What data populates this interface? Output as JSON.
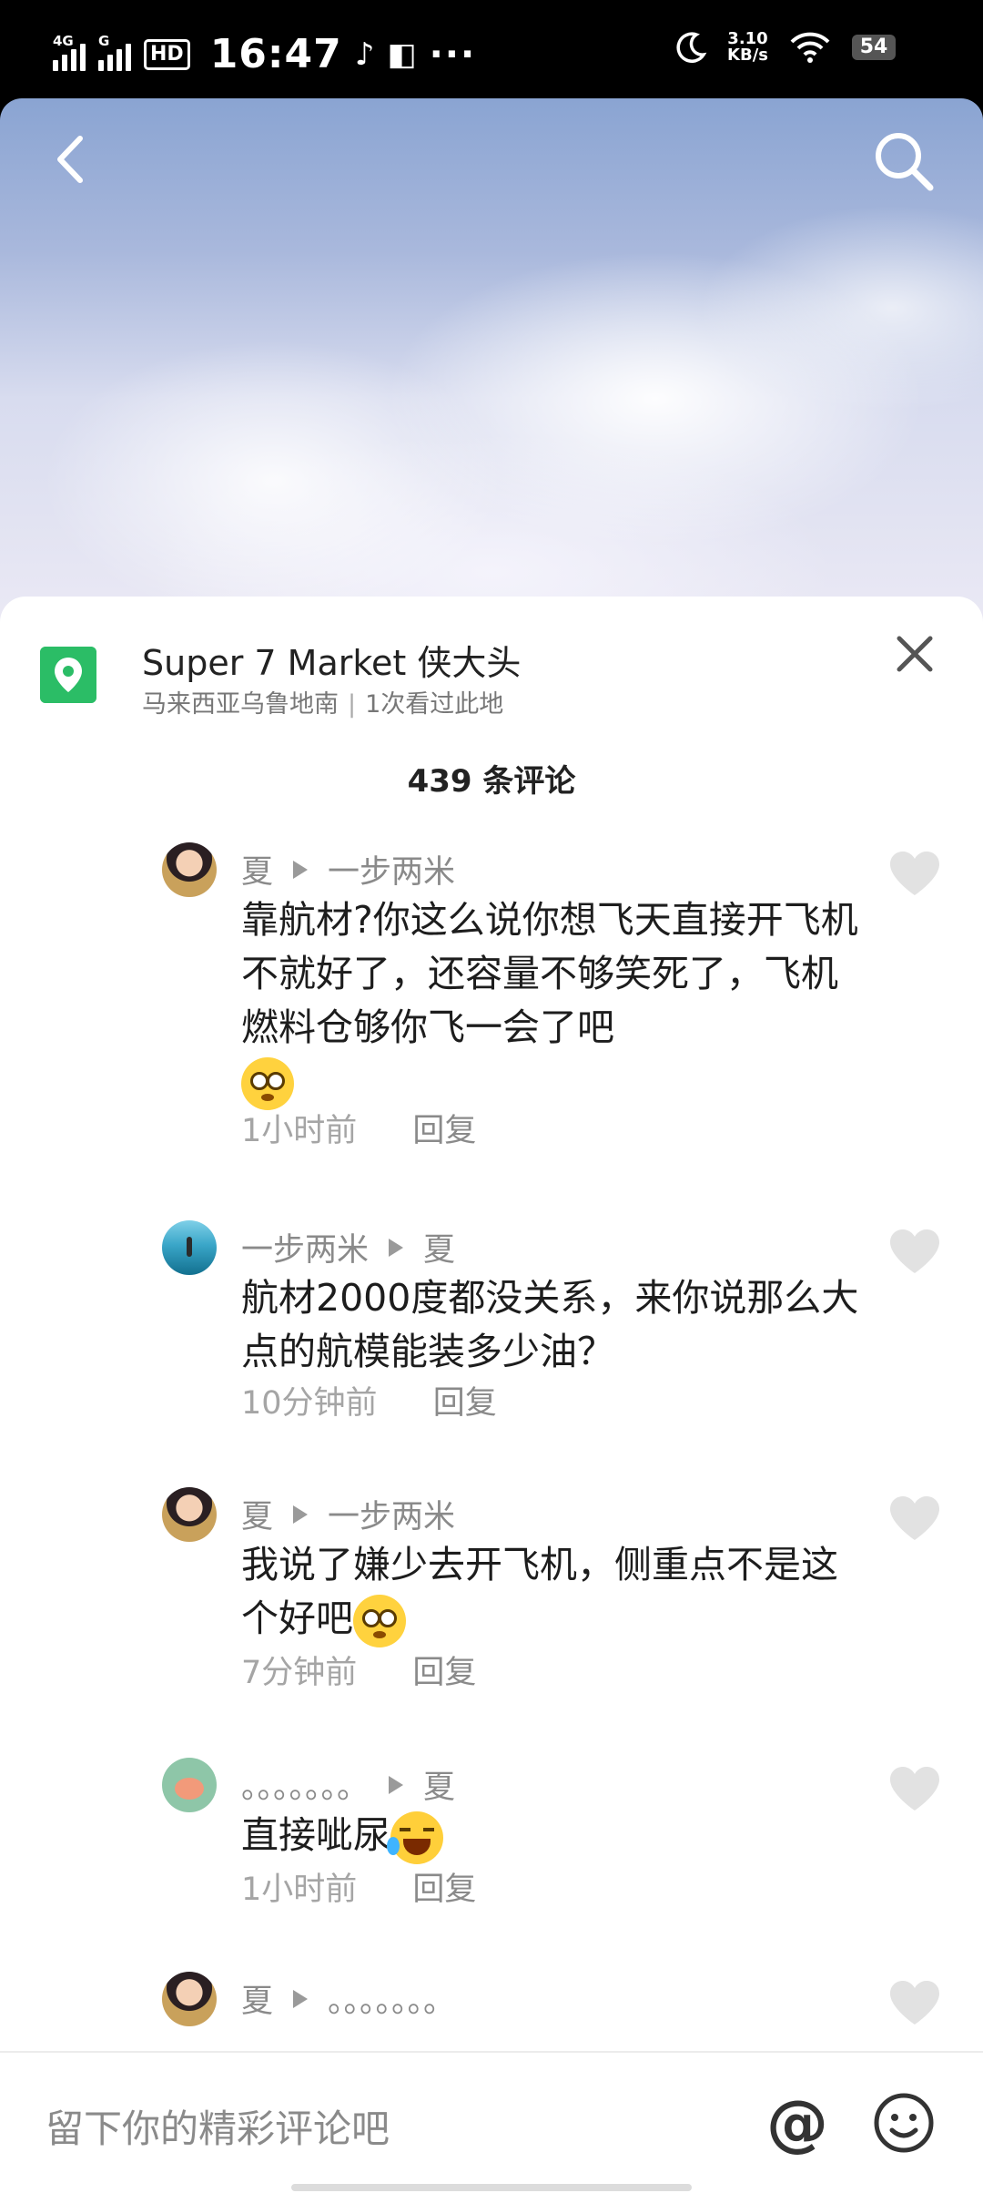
{
  "status_bar": {
    "network_1": "4G",
    "network_2": "G",
    "hd": "HD",
    "time": "16:47",
    "speed_value": "3.10",
    "speed_unit": "KB/s",
    "battery": "54",
    "icons": [
      "signal-icon",
      "signal-icon",
      "hd-icon",
      "tiktok-icon",
      "app-icon",
      "more-dots-icon",
      "moon-icon",
      "wifi-icon",
      "battery-icon"
    ]
  },
  "header": {
    "back_icon": "chevron-left-icon",
    "search_icon": "search-icon"
  },
  "location": {
    "title": "Super 7 Market 侠大头",
    "subtitle": "马来西亚乌鲁地南",
    "separator": "|",
    "views": "1次看过此地",
    "icon_color": "#2bbd66"
  },
  "comment_count": "439 条评论",
  "comments": [
    {
      "author": "夏",
      "reply_to": "一步两米",
      "text": "靠航材?你这么说你想飞天直接开飞机不就好了，还容量不够笑死了，飞机燃料仓够你飞一会了吧",
      "emoji": "flushed-emoji",
      "time": "1小时前",
      "reply_label": "回复"
    },
    {
      "author": "一步两米",
      "reply_to": "夏",
      "text": "航材2000度都没关系，来你说那么大点的航模能装多少油？",
      "time": "10分钟前",
      "reply_label": "回复"
    },
    {
      "author": "夏",
      "reply_to": "一步两米",
      "text": "我说了嫌少去开飞机，侧重点不是这个好吧",
      "emoji": "flushed-emoji",
      "time": "7分钟前",
      "reply_label": "回复"
    },
    {
      "author": "。。。。。。。",
      "reply_to": "夏",
      "text": "直接呲尿",
      "emoji": "rolling-laughing-emoji",
      "time": "1小时前",
      "reply_label": "回复"
    },
    {
      "author": "夏",
      "reply_to": "。。。。。。。"
    }
  ],
  "input_bar": {
    "placeholder": "留下你的精彩评论吧",
    "at_label": "@",
    "emoji_icon": "smiley-icon"
  }
}
